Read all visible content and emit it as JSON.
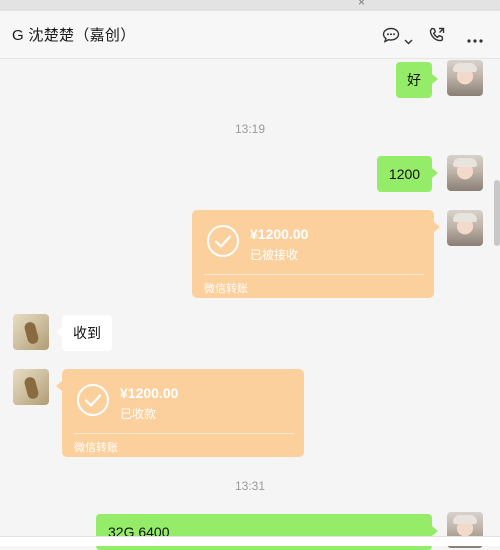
{
  "header": {
    "title": "G 沈楚楚（嘉创）",
    "icons": [
      "chat-bubble-icon",
      "chevron-down-icon",
      "phone-icon",
      "more-icon"
    ]
  },
  "window": {
    "close_glyph": "×"
  },
  "messages": {
    "m1": {
      "text": "好"
    },
    "time1": "13:19",
    "m2": {
      "text": "1200"
    },
    "t1": {
      "amount": "¥1200.00",
      "status": "已被接收",
      "brand": "微信转账"
    },
    "m3": {
      "text": "收到"
    },
    "t2": {
      "amount": "¥1200.00",
      "status": "已收款",
      "brand": "微信转账"
    },
    "time2": "13:31",
    "m4": {
      "text": "32G 6400"
    }
  },
  "colors": {
    "self_bubble": "#95ec69",
    "other_bubble": "#ffffff",
    "transfer": "#fcd09c",
    "background": "#f5f5f5"
  }
}
